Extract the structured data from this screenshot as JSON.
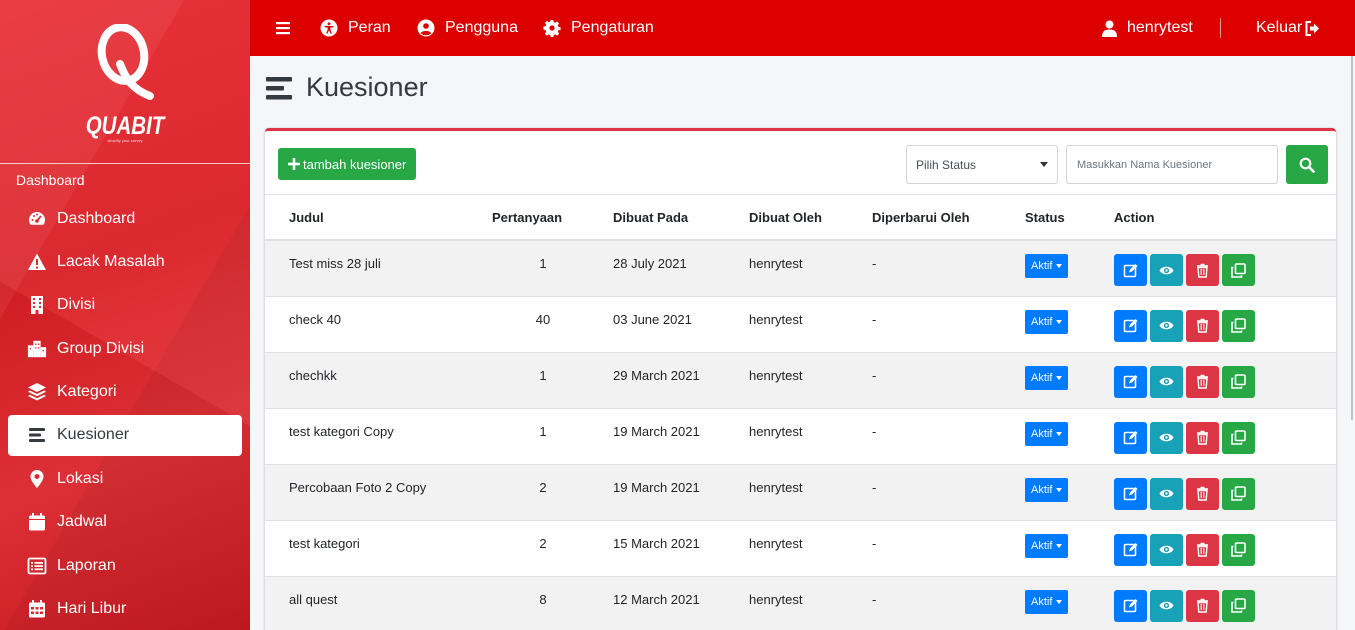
{
  "brand": {
    "name": "QUABIT",
    "tagline": "simplify your survey"
  },
  "sidebar": {
    "header": "Dashboard",
    "items": [
      {
        "label": "Dashboard",
        "icon": "tachometer-icon"
      },
      {
        "label": "Lacak Masalah",
        "icon": "warning-icon"
      },
      {
        "label": "Divisi",
        "icon": "building-icon"
      },
      {
        "label": "Group Divisi",
        "icon": "city-icon"
      },
      {
        "label": "Kategori",
        "icon": "layers-icon"
      },
      {
        "label": "Kuesioner",
        "icon": "list-icon",
        "active": true
      },
      {
        "label": "Lokasi",
        "icon": "map-marker-icon"
      },
      {
        "label": "Jadwal",
        "icon": "calendar-icon"
      },
      {
        "label": "Laporan",
        "icon": "report-icon"
      },
      {
        "label": "Hari Libur",
        "icon": "calendar-grid-icon"
      }
    ]
  },
  "topbar": {
    "menu_icon": "hamburger-icon",
    "links": [
      {
        "label": "Peran",
        "icon": "accessibility-icon"
      },
      {
        "label": "Pengguna",
        "icon": "user-circle-icon"
      },
      {
        "label": "Pengaturan",
        "icon": "gear-icon"
      }
    ],
    "user": "henrytest",
    "logout": "Keluar"
  },
  "page": {
    "title": "Kuesioner"
  },
  "toolbar": {
    "add_label": "tambah kuesioner",
    "status_select": "Pilih Status",
    "search_placeholder": "Masukkan Nama Kuesioner"
  },
  "table": {
    "columns": [
      "Judul",
      "Pertanyaan",
      "Dibuat Pada",
      "Dibuat Oleh",
      "Diperbarui Oleh",
      "Status",
      "Action"
    ],
    "rows": [
      {
        "judul": "Test miss 28 juli",
        "pertanyaan": "1",
        "dibuat_pada": "28 July 2021",
        "dibuat_oleh": "henrytest",
        "diperbarui_oleh": "-",
        "status": "Aktif"
      },
      {
        "judul": "check 40",
        "pertanyaan": "40",
        "dibuat_pada": "03 June 2021",
        "dibuat_oleh": "henrytest",
        "diperbarui_oleh": "-",
        "status": "Aktif"
      },
      {
        "judul": "chechkk",
        "pertanyaan": "1",
        "dibuat_pada": "29 March 2021",
        "dibuat_oleh": "henrytest",
        "diperbarui_oleh": "-",
        "status": "Aktif"
      },
      {
        "judul": "test kategori Copy",
        "pertanyaan": "1",
        "dibuat_pada": "19 March 2021",
        "dibuat_oleh": "henrytest",
        "diperbarui_oleh": "-",
        "status": "Aktif"
      },
      {
        "judul": "Percobaan Foto 2 Copy",
        "pertanyaan": "2",
        "dibuat_pada": "19 March 2021",
        "dibuat_oleh": "henrytest",
        "diperbarui_oleh": "-",
        "status": "Aktif"
      },
      {
        "judul": "test kategori",
        "pertanyaan": "2",
        "dibuat_pada": "15 March 2021",
        "dibuat_oleh": "henrytest",
        "diperbarui_oleh": "-",
        "status": "Aktif"
      },
      {
        "judul": "all quest",
        "pertanyaan": "8",
        "dibuat_pada": "12 March 2021",
        "dibuat_oleh": "henrytest",
        "diperbarui_oleh": "-",
        "status": "Aktif"
      }
    ]
  },
  "colors": {
    "primary_red": "#dc0000",
    "green": "#28a745",
    "blue": "#007bff",
    "teal": "#17a2b8",
    "danger": "#dc3545"
  }
}
